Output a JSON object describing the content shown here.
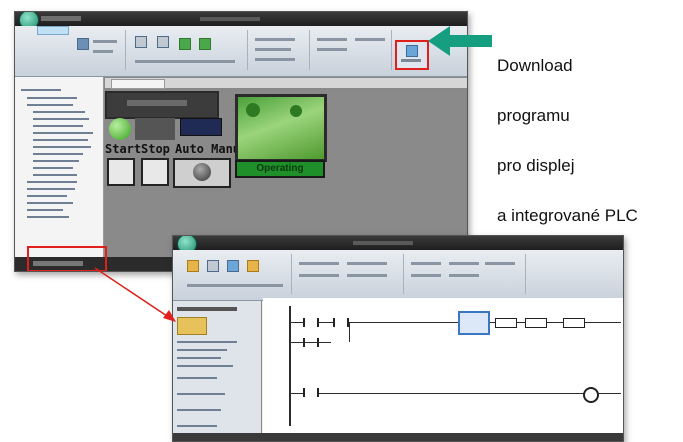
{
  "annotation": {
    "line1": "Download",
    "line2": "programu",
    "line3": "pro displej",
    "line4": "a integrované PLC"
  },
  "screenshot_hmi": {
    "hmi_buttons": [
      "Start",
      "Stop",
      "Auto Manual"
    ],
    "status_label": "Operating"
  },
  "colors": {
    "arrow": "#169e80",
    "highlight": "#e0201c",
    "selected_instruction": "#3a76c4"
  },
  "icons": [
    "app-orb-icon",
    "download-icon",
    "arrow-left-icon",
    "red-pointer-arrow-icon"
  ]
}
